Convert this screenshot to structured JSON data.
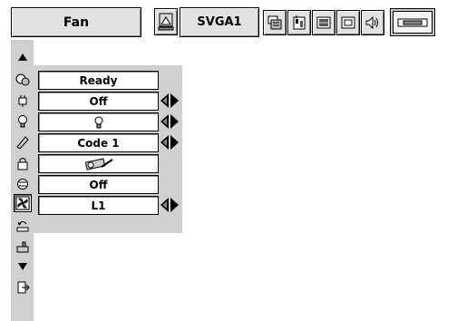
{
  "header": {
    "title": "Fan",
    "source": "SVGA1"
  },
  "toolbar": {
    "icons": [
      "input-source-icon",
      "pc-adjust-icon",
      "image-adjust-icon",
      "image-select-icon",
      "screen-icon",
      "sound-icon",
      "setting-icon"
    ],
    "selected": "setting-icon"
  },
  "sidebar": {
    "items": [
      "scroll-up-icon",
      "language-icon",
      "power-management-icon",
      "lamp-icon",
      "remote-control-icon",
      "security-lock-icon",
      "ceiling-icon",
      "fan-icon",
      "filter-counter-icon",
      "factory-default-icon",
      "scroll-down-icon",
      "exit-icon"
    ],
    "selected": "fan-icon"
  },
  "settings": {
    "rows": [
      {
        "value": "Ready",
        "has_arrows": false
      },
      {
        "value": "Off",
        "has_arrows": true
      },
      {
        "value": "",
        "icon": "lamp-icon",
        "has_arrows": true
      },
      {
        "value": "Code 1",
        "has_arrows": true
      },
      {
        "value": "",
        "icon": "ceiling-projector-icon",
        "has_arrows": false
      },
      {
        "value": "Off",
        "has_arrows": false
      },
      {
        "value": "L1",
        "has_arrows": true
      }
    ]
  },
  "colors": {
    "panel": "#d0d0d0",
    "field": "#ffffff",
    "frame": "#000000"
  }
}
